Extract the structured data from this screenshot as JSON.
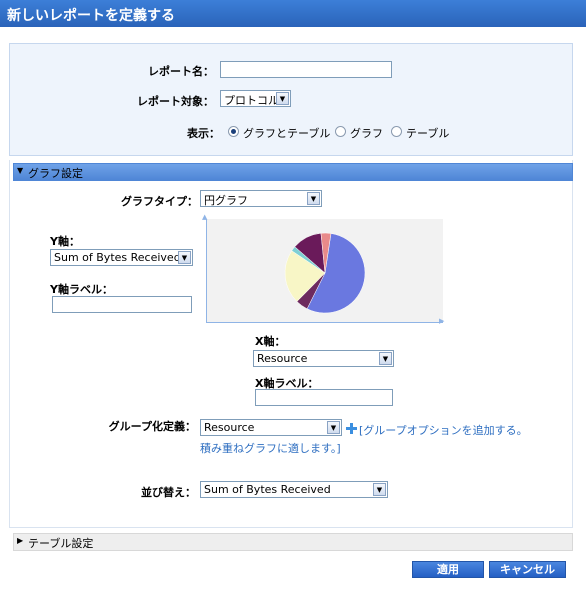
{
  "title": "新しいレポートを定義する",
  "report": {
    "name_label": "レポート名：",
    "name_value": "",
    "target_label": "レポート対象：",
    "target_value": "プロトコル",
    "display_label": "表示：",
    "display_options": [
      "グラフとテーブル",
      "グラフ",
      "テーブル"
    ],
    "display_selected": "グラフとテーブル"
  },
  "graph_section": {
    "title": "グラフ設定",
    "type_label": "グラフタイプ：",
    "type_value": "円グラフ",
    "y_axis_label": "Y軸：",
    "y_axis_value": "Sum of Bytes Received",
    "y_label_label": "Y軸ラベル：",
    "y_label_value": "",
    "x_axis_label": "X軸：",
    "x_axis_value": "Resource",
    "x_label_label": "X軸ラベル：",
    "x_label_value": "",
    "group_label": "グループ化定義：",
    "group_value": "Resource",
    "group_link_line1": "[グループオプションを追加する。",
    "group_link_line2": "積み重ねグラフに適します。]",
    "sort_label": "並び替え：",
    "sort_value": "Sum of Bytes Received"
  },
  "table_section": {
    "title": "テーブル設定"
  },
  "buttons": {
    "apply": "適用",
    "cancel": "キャンセル"
  },
  "chart_data": {
    "type": "pie",
    "values": [
      55,
      5,
      22,
      2,
      12,
      4
    ],
    "colors": [
      "#6a78e0",
      "#6d2a5e",
      "#f8f6c6",
      "#7fd0d4",
      "#6a1a5a",
      "#e88a8a"
    ]
  }
}
